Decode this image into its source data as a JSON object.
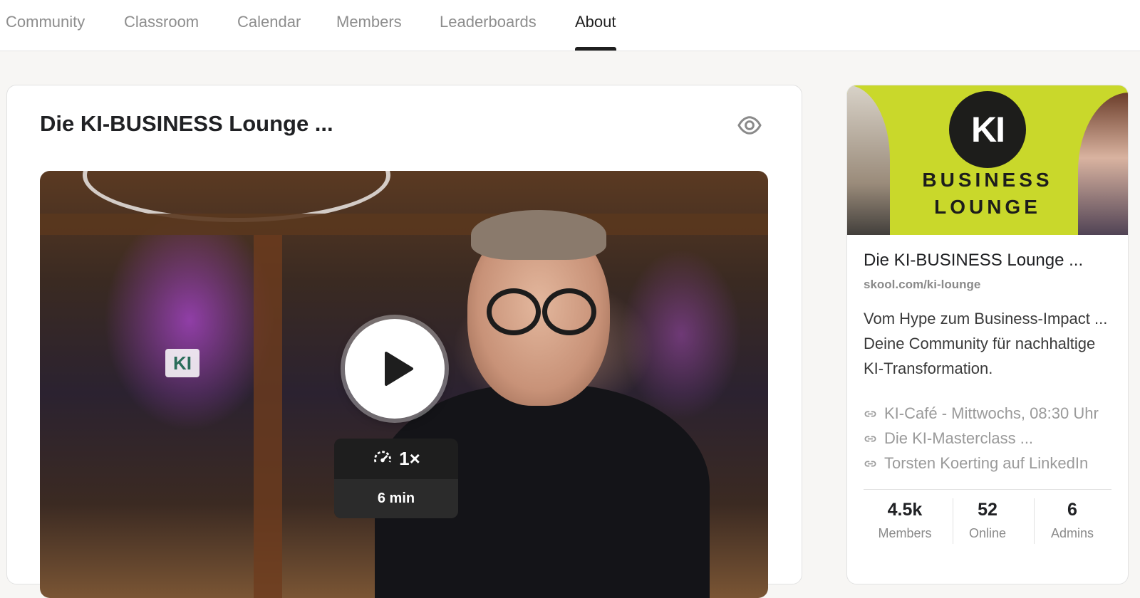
{
  "nav": {
    "tabs": [
      {
        "label": "Community"
      },
      {
        "label": "Classroom"
      },
      {
        "label": "Calendar"
      },
      {
        "label": "Members"
      },
      {
        "label": "Leaderboards"
      },
      {
        "label": "About",
        "active": true
      }
    ]
  },
  "main": {
    "title": "Die KI-BUSINESS Lounge ...",
    "visibility_icon": "eye-icon",
    "video": {
      "play_icon": "play-icon",
      "speed_icon": "playback-speed-icon",
      "speed": "1×",
      "duration": "6 min",
      "logo_text": "KI"
    }
  },
  "sidebar": {
    "banner": {
      "logo": "KI",
      "line1": "BUSINESS",
      "line2": "LOUNGE",
      "accent": "#c9d82b"
    },
    "title": "Die KI-BUSINESS Lounge ...",
    "url": "skool.com/ki-lounge",
    "description": "Vom Hype zum Business-Impact ... Deine Community für nachhaltige KI-Transformation.",
    "links": [
      {
        "label": "KI-Café - Mittwochs, 08:30 Uhr",
        "icon": "link-icon"
      },
      {
        "label": "Die KI-Masterclass ...",
        "icon": "link-icon"
      },
      {
        "label": "Torsten Koerting auf LinkedIn",
        "icon": "link-icon"
      }
    ],
    "stats": [
      {
        "value": "4.5k",
        "label": "Members"
      },
      {
        "value": "52",
        "label": "Online"
      },
      {
        "value": "6",
        "label": "Admins"
      }
    ]
  }
}
